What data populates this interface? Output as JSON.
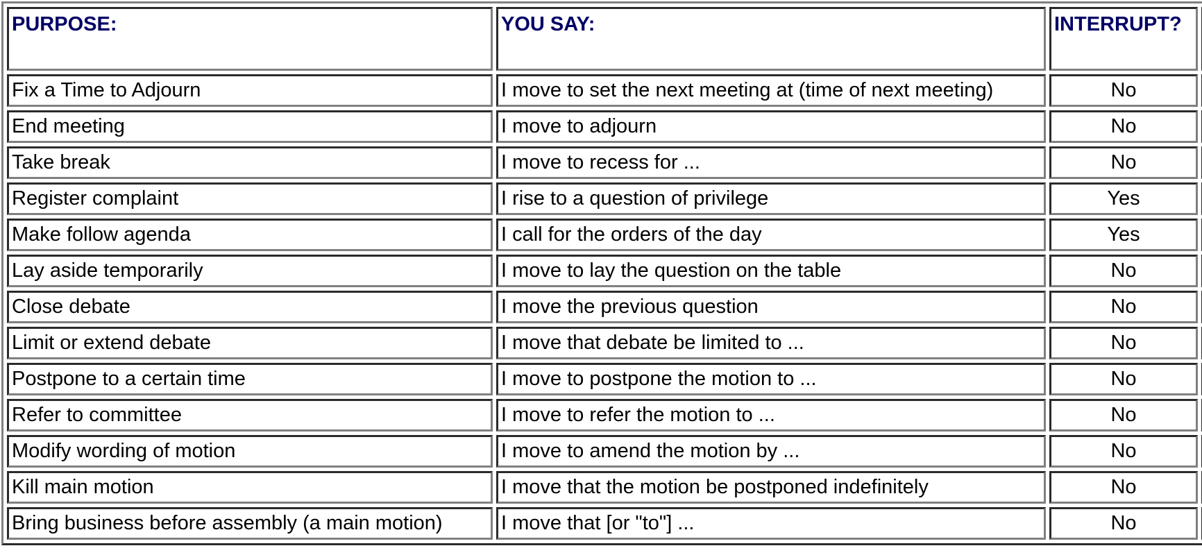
{
  "table": {
    "headers": {
      "purpose": "PURPOSE:",
      "you_say": "YOU SAY:",
      "interrupt": "INTERRUPT?",
      "fourth": ""
    },
    "header_color": "#000066",
    "rows": [
      {
        "purpose": "Fix a Time to Adjourn",
        "you_say": "I move to set the next meeting at (time of next meeting)",
        "interrupt": "No"
      },
      {
        "purpose": "End meeting",
        "you_say": "I move to adjourn",
        "interrupt": "No"
      },
      {
        "purpose": "Take break",
        "you_say": "I move to recess for ...",
        "interrupt": "No"
      },
      {
        "purpose": "Register complaint",
        "you_say": "I rise to a question of privilege",
        "interrupt": "Yes"
      },
      {
        "purpose": "Make follow agenda",
        "you_say": "I call for the orders of the day",
        "interrupt": "Yes"
      },
      {
        "purpose": "Lay aside temporarily",
        "you_say": "I move to lay the question on the table",
        "interrupt": "No"
      },
      {
        "purpose": "Close debate",
        "you_say": "I move the previous question",
        "interrupt": "No"
      },
      {
        "purpose": "Limit or extend debate",
        "you_say": "I move that debate be limited to ...",
        "interrupt": "No"
      },
      {
        "purpose": "Postpone to a certain time",
        "you_say": "I move to postpone the motion to ...",
        "interrupt": "No"
      },
      {
        "purpose": "Refer to committee",
        "you_say": "I move to refer the motion to ...",
        "interrupt": "No"
      },
      {
        "purpose": "Modify wording of motion",
        "you_say": "I move to amend the motion by ...",
        "interrupt": "No"
      },
      {
        "purpose": "Kill main motion",
        "you_say": "I move that the motion be postponed indefinitely",
        "interrupt": "No"
      },
      {
        "purpose": "Bring business before assembly (a main motion)",
        "you_say": "I move that [or \"to\"] ...",
        "interrupt": "No"
      }
    ]
  }
}
